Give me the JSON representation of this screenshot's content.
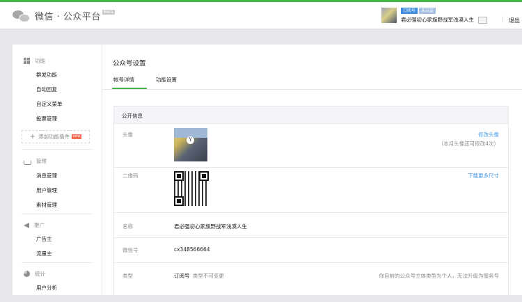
{
  "header": {
    "logo_text": "微信 · 公众平台",
    "beta_label": "Beta",
    "account": {
      "tag_type": "订阅号",
      "tag_status": "未认证",
      "name": "君必强初心家旗野战军浅漠人生"
    },
    "logout": "退出"
  },
  "sidebar": {
    "sections": [
      {
        "title": "功能",
        "icon": "grid-icon",
        "items": [
          "群发功能",
          "自动回复",
          "自定义菜单",
          "投票管理"
        ]
      },
      {
        "title": "管理",
        "icon": "inbox-icon",
        "items": [
          "消息管理",
          "用户管理",
          "素材管理"
        ]
      },
      {
        "title": "推广",
        "icon": "megaphone-icon",
        "items": [
          "广告主",
          "流量主"
        ]
      },
      {
        "title": "统计",
        "icon": "pie-chart-icon",
        "items": [
          "用户分析"
        ]
      }
    ],
    "add_plugin": "添加功能插件",
    "new_badge": "new"
  },
  "main": {
    "title": "公众号设置",
    "tabs": [
      "帐号详情",
      "功能设置"
    ],
    "active_tab": 0,
    "card": {
      "title": "公开信息",
      "avatar": {
        "label": "头像",
        "link": "修改头像",
        "note": "（本月头像还可修改4次）"
      },
      "qrcode": {
        "label": "二维码",
        "link": "下载更多尺寸"
      },
      "name": {
        "label": "名称",
        "value": "君必强初心家旗野战军浅漠人生"
      },
      "wechat_id": {
        "label": "微信号",
        "value": "cx348566664"
      },
      "type": {
        "label": "类型",
        "value": "订阅号",
        "value_note": "类型不可变更",
        "note": "你目前的公众号主体类型为个人，无法升级为服务号"
      }
    }
  },
  "colors": {
    "accent_green": "#44b549",
    "link_blue": "#459ae9",
    "muted": "#8d8d8d"
  }
}
